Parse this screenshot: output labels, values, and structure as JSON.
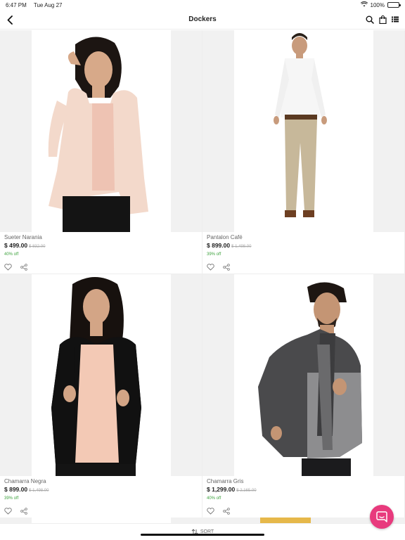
{
  "status_bar": {
    "time": "6:47 PM",
    "date": "Tue Aug 27",
    "battery": "100%",
    "battery_level": 1.0
  },
  "nav": {
    "title": "Dockers",
    "back_icon": "chevron-left-icon",
    "actions": [
      "search-icon",
      "shopping-bag-icon",
      "list-view-icon"
    ]
  },
  "products": [
    {
      "name": "Sueter Narania",
      "price": "$ 499.00",
      "original_price": "$ 832.00",
      "discount": "40% off",
      "colors": {
        "background": "#f1f1f1",
        "garment": "#f3d9cb",
        "inner": "#eec3b3",
        "bottom": "#141414",
        "hair": "#1c1512",
        "skin": "#d7a989"
      }
    },
    {
      "name": "Pantalon Café",
      "price": "$ 899.00",
      "original_price": "$ 1,498.00",
      "discount": "39% off",
      "colors": {
        "background": "#f1f1f1",
        "garment": "#f6f6f6",
        "inner": "#d2c3a8",
        "bottom": "#c7b89a",
        "hair": "#2a211a",
        "skin": "#c89b7c"
      }
    },
    {
      "name": "Chamarra Negra",
      "price": "$ 899.00",
      "original_price": "$ 1,498.00",
      "discount": "39% off",
      "colors": {
        "background": "#f1f1f1",
        "garment": "#111111",
        "inner": "#f3c9b5",
        "bottom": "#141414",
        "hair": "#17110e",
        "skin": "#d3a586"
      }
    },
    {
      "name": "Chamarra Gris",
      "price": "$ 1,299.00",
      "original_price": "$ 2,165.00",
      "discount": "40% off",
      "colors": {
        "background": "#f1f1f1",
        "garment": "#8d8d8f",
        "inner": "#3c3c3e",
        "bottom": "#1b1b1d",
        "hair": "#1d1612",
        "skin": "#c49574"
      }
    }
  ],
  "sort_bar": {
    "label": "SORT",
    "icon": "sort-icon"
  },
  "chat_button": {
    "icon": "chat-bubble-icon",
    "color": "#e83a7d"
  },
  "accent": {
    "discount": "#3fa33f"
  }
}
